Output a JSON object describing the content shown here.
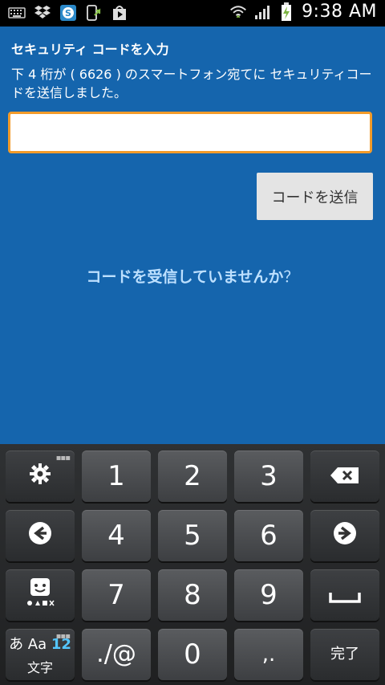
{
  "status_bar": {
    "time": "9:38 AM",
    "left_icons": [
      "keyboard-icon",
      "dropbox-icon",
      "skype-icon",
      "phone-update-icon",
      "play-store-icon"
    ],
    "right_icons": [
      "wifi-icon",
      "signal-icon",
      "battery-charging-icon"
    ]
  },
  "page": {
    "title": "セキュリティ コードを入力",
    "description": "下 4 桁が ( 6626 ) のスマートフォン宛てに セキュリティコードを送信しました。",
    "code_input_value": "",
    "send_button_label": "コードを送信",
    "resend_link_text": "コードを受信していませんか",
    "resend_link_suffix": "？"
  },
  "keyboard": {
    "keys": {
      "settings": "⚙",
      "one": "1",
      "two": "2",
      "three": "3",
      "backspace": "⌫",
      "left": "←",
      "four": "4",
      "five": "5",
      "six": "6",
      "right": "→",
      "emoji": "☺",
      "seven": "7",
      "eight": "8",
      "nine": "9",
      "space": "␣",
      "mode_top_a": "あ Aa",
      "mode_top_num": "12",
      "mode_bottom": "文字",
      "symbols": "./@",
      "zero": "0",
      "punct": ",.",
      "done": "完了"
    }
  },
  "colors": {
    "background": "#1565ad",
    "input_border": "#f29b2a",
    "link": "#bde0ff",
    "accent_num": "#54c6ff"
  }
}
